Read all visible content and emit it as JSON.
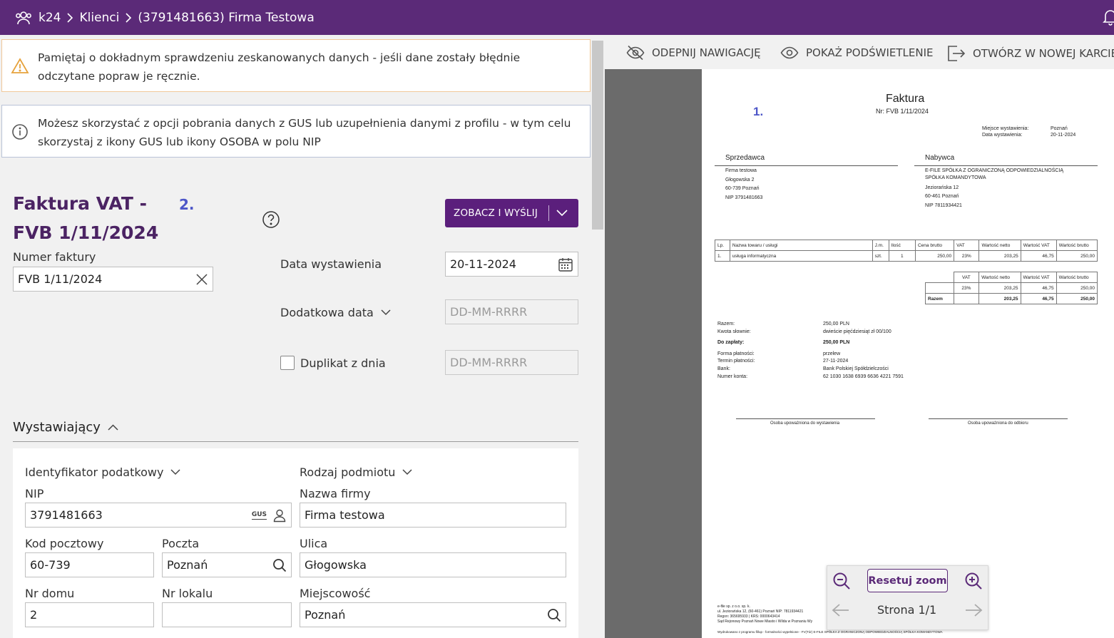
{
  "breadcrumb": {
    "root": "k24",
    "section": "Klienci",
    "current": "(3791481663) Firma Testowa"
  },
  "alerts": {
    "warning": "Pamiętaj o dokładnym sprawdzeniu zeskanowanych danych - jeśli dane zostały błędnie odczytane popraw je ręcznie.",
    "info": "Możesz skorzystać z opcji pobrania danych z GUS lub uzupełnienia danymi z profilu - w tym celu skorzystaj z ikony GUS lub ikony OSOBA w polu NIP"
  },
  "form": {
    "title": "Faktura VAT - FVB 1/11/2024",
    "marker": "2.",
    "send_button": "ZOBACZ I WYŚLIJ",
    "invoice_number_label": "Numer faktury",
    "invoice_number_value": "FVB 1/11/2024",
    "issue_date_label": "Data wystawienia",
    "issue_date_value": "20-11-2024",
    "extra_date_label": "Dodatkowa data",
    "extra_date_placeholder": "DD-MM-RRRR",
    "duplicate_label": "Duplikat z dnia",
    "duplicate_placeholder": "DD-MM-RRRR"
  },
  "issuer": {
    "section_title": "Wystawiający",
    "tax_id_type_label": "Identyfikator podatkowy",
    "entity_type_label": "Rodzaj podmiotu",
    "nip_label": "NIP",
    "nip_value": "3791481663",
    "gus_label": "GUS",
    "company_label": "Nazwa firmy",
    "company_value": "Firma testowa",
    "postal_code_label": "Kod pocztowy",
    "postal_code_value": "60-739",
    "post_office_label": "Poczta",
    "post_office_value": "Poznań",
    "street_label": "Ulica",
    "street_value": "Głogowska",
    "house_no_label": "Nr domu",
    "house_no_value": "2",
    "apartment_label": "Nr lokalu",
    "apartment_value": "",
    "city_label": "Miejscowość",
    "city_value": "Poznań"
  },
  "viewer_toolbar": {
    "unpin": "ODEPNIJ NAWIGACJĘ",
    "highlight": "POKAŻ PODŚWIETLENIE",
    "open_new": "OTWÓRZ W NOWEJ KARCIE"
  },
  "preview": {
    "marker": "1.",
    "title": "Faktura",
    "number": "Nr: FVB 1/11/2024",
    "place_label": "Miejsce wystawienia:",
    "place_value": "Poznań",
    "date_label": "Data wystawienia:",
    "date_value": "20-11-2024",
    "seller_heading": "Sprzedawca",
    "seller_lines": [
      "Firma testowa",
      "Głogowska 2",
      "60-739 Poznań",
      "NIP 3791481663"
    ],
    "buyer_heading": "Nabywca",
    "buyer_lines": [
      "E-FILE SPÓŁKA Z OGRANICZONĄ ODPOWIEDZIALNOŚCIĄ",
      "SPÓŁKA KOMANDYTOWA",
      "Jeziorańska 12",
      "60-461 Poznań",
      "NIP 7811934421"
    ],
    "items_header": [
      "Lp.",
      "Nazwa towaru / usługi",
      "J.m.",
      "Ilość",
      "Cena brutto",
      "VAT",
      "Wartość netto",
      "Wartość VAT",
      "Wartość brutto"
    ],
    "items_row": [
      "1.",
      "usługa informatyczna",
      "szt.",
      "1",
      "250,00",
      "23%",
      "203,25",
      "46,75",
      "250,00"
    ],
    "summary_header": [
      "VAT",
      "Wartość netto",
      "Wartość VAT",
      "Wartość brutto"
    ],
    "summary_row": [
      "23%",
      "203,25",
      "46,75",
      "250,00"
    ],
    "summary_total": [
      "Razem",
      "",
      "203,25",
      "46,75",
      "250,00"
    ],
    "totals": [
      {
        "label": "Razem:",
        "value": "250,00 PLN"
      },
      {
        "label": "Kwota słownie:",
        "value": "dwieście pięćdziesiąt zł 00/100"
      },
      {
        "label": "Do zapłaty:",
        "value": "250,00 PLN"
      },
      {
        "label": "Forma płatności:",
        "value": "przelew"
      },
      {
        "label": "Termin płatności:",
        "value": "27-11-2024"
      },
      {
        "label": "Bank:",
        "value": "Bank Polskiej Spółdzielczości"
      },
      {
        "label": "Numer konta:",
        "value": "62 1030 1638 6939 6636 4221 7591"
      }
    ],
    "sign_issuer": "Osoba upoważniona do wystawienia",
    "sign_receiver": "Osoba upoważniona do odbioru",
    "footer_lines": [
      "e-file sp. z o.o. sp. k.",
      "ul. Jeziorańska 12, (60-461) Poznań NIP: 7811934421",
      "Regon: 365695933 | KRS: 0000643414",
      "Sąd Rejonowy Poznań Nowe Miasto i Wilda w Poznaniu Wy"
    ],
    "footer_bottom": "Wydrukowano z programu fillup - formalności wypełnione - FV(Tór) E-FILE SPÓŁKA Z OGRANICZONĄ ODPOWIEDZIALNOŚCIĄ SPÓŁKA KOMANDYTOWA"
  },
  "zoom": {
    "reset": "Resetuj zoom",
    "page": "Strona 1/1"
  },
  "colors": {
    "brand": "#5b2a78",
    "marker": "#4d56c8"
  }
}
